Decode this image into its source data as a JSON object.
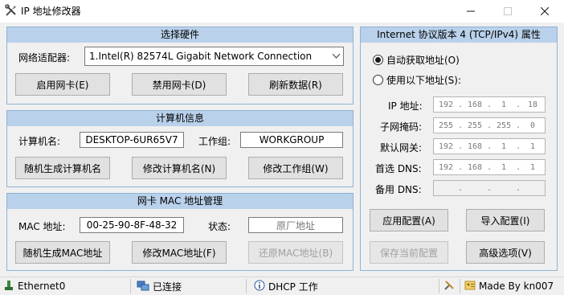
{
  "window": {
    "title": "IP 地址修改器",
    "minimize_icon": "minimize-icon",
    "maximize_icon": "maximize-icon",
    "close_icon": "close-icon"
  },
  "hardware": {
    "header": "选择硬件",
    "adapter_label": "网络适配器:",
    "adapter_selected": "1.Intel(R) 82574L Gigabit Network Connection",
    "enable_button": "启用网卡(E)",
    "disable_button": "禁用网卡(D)",
    "refresh_button": "刷新数据(R)"
  },
  "computer": {
    "header": "计算机信息",
    "name_label": "计算机名:",
    "name_value": "DESKTOP-6UR65V7",
    "workgroup_label": "工作组:",
    "workgroup_value": "WORKGROUP",
    "random_name_button": "随机生成计算机名",
    "rename_button": "修改计算机名(N)",
    "workgroup_button": "修改工作组(W)"
  },
  "mac": {
    "header": "网卡 MAC 地址管理",
    "mac_label": "MAC 地址:",
    "mac_value": "00-25-90-8F-48-32",
    "status_label": "状态:",
    "status_value": "原厂地址",
    "random_mac_button": "随机生成MAC地址",
    "change_mac_button": "修改MAC地址(F)",
    "restore_mac_button": "还原MAC地址(B)"
  },
  "ipv4": {
    "header": "Internet 协议版本 4 (TCP/IPv4) 属性",
    "auto_radio": "自动获取地址(O)",
    "manual_radio": "使用以下地址(S):",
    "ip_label": "IP 地址:",
    "ip": [
      "192",
      "168",
      "1",
      "18"
    ],
    "mask_label": "子网掩码:",
    "mask": [
      "255",
      "255",
      "255",
      "0"
    ],
    "gateway_label": "默认网关:",
    "gateway": [
      "192",
      "168",
      "1",
      "1"
    ],
    "dns1_label": "首选 DNS:",
    "dns1": [
      "192",
      "168",
      "1",
      "1"
    ],
    "dns2_label": "备用 DNS:",
    "dns2": [
      "",
      "",
      "",
      ""
    ],
    "apply_button": "应用配置(A)",
    "import_button": "导入配置(I)",
    "save_button": "保存当前配置",
    "advanced_button": "高级选项(V)"
  },
  "status": {
    "adapter": "Ethernet0",
    "connection": "已连接",
    "mode": "DHCP 工作",
    "credit": "Made By kn007"
  }
}
